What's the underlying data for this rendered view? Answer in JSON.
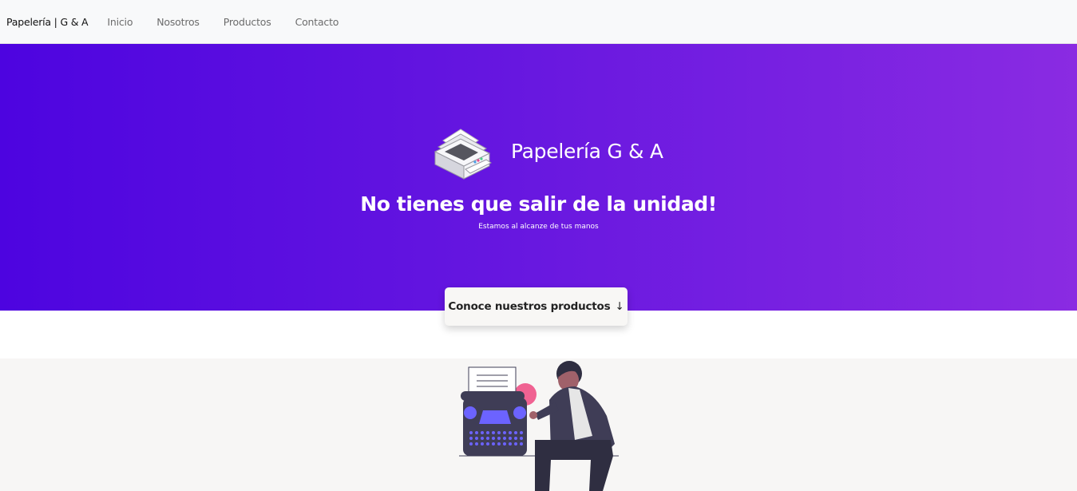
{
  "navbar": {
    "brand": "Papelería | G & A",
    "links": [
      "Inicio",
      "Nosotros",
      "Productos",
      "Contacto"
    ]
  },
  "hero": {
    "title": "Papelería G & A",
    "heading": "No tienes que salir de la unidad!",
    "subtitle": "Estamos al alcanze de tus manos",
    "icon": "printer-icon"
  },
  "cta": {
    "label": "Conoce nuestros productos",
    "arrow": "↓"
  },
  "illustration": {
    "icon": "person-typewriter-illustration"
  },
  "colors": {
    "gradient_start": "#4d04e0",
    "gradient_end": "#8a2be2",
    "navbar_bg": "#f8f9fa",
    "lower_bg": "#f7f6f5",
    "illustration_accent": "#6c63ff"
  }
}
